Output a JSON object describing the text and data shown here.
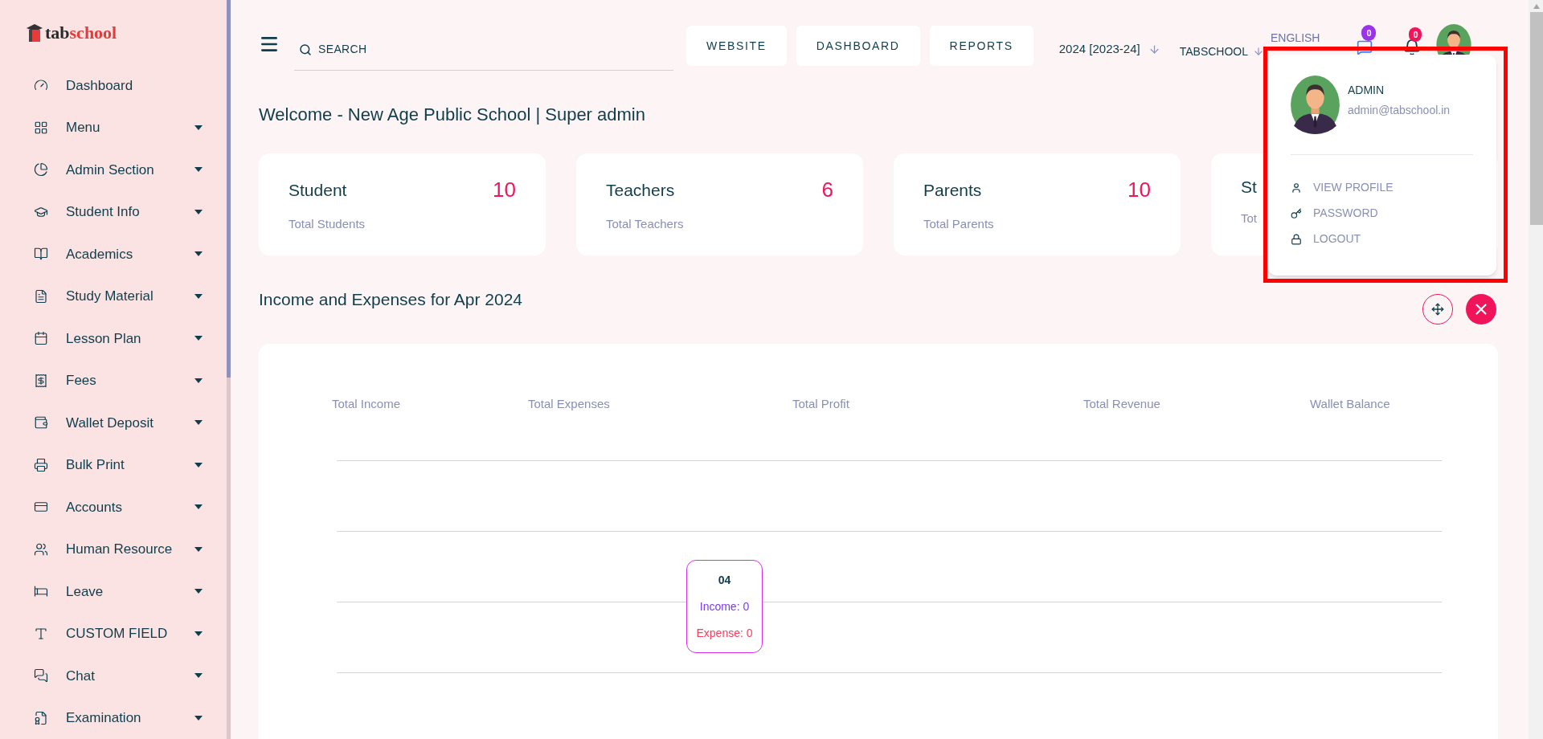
{
  "sidebar": {
    "logo": {
      "part1": "tab",
      "part2": "school"
    },
    "items": [
      {
        "label": "Dashboard",
        "has_submenu": false
      },
      {
        "label": "Menu",
        "has_submenu": true
      },
      {
        "label": "Admin Section",
        "has_submenu": true
      },
      {
        "label": "Student Info",
        "has_submenu": true
      },
      {
        "label": "Academics",
        "has_submenu": true
      },
      {
        "label": "Study Material",
        "has_submenu": true
      },
      {
        "label": "Lesson Plan",
        "has_submenu": true
      },
      {
        "label": "Fees",
        "has_submenu": true
      },
      {
        "label": "Wallet Deposit",
        "has_submenu": true
      },
      {
        "label": "Bulk Print",
        "has_submenu": true
      },
      {
        "label": "Accounts",
        "has_submenu": true
      },
      {
        "label": "Human Resource",
        "has_submenu": true
      },
      {
        "label": "Leave",
        "has_submenu": true
      },
      {
        "label": "CUSTOM FIELD",
        "has_submenu": true
      },
      {
        "label": "Chat",
        "has_submenu": true
      },
      {
        "label": "Examination",
        "has_submenu": true
      }
    ]
  },
  "header": {
    "search": {
      "placeholder": "SEARCH"
    },
    "nav_buttons": [
      "WEBSITE",
      "DASHBOARD",
      "REPORTS"
    ],
    "session": "2024 [2023-24]",
    "school": "TABSCHOOL",
    "language": "ENGLISH",
    "messages_badge": "0",
    "notifications_badge": "0"
  },
  "welcome": "Welcome - New Age Public School | Super admin",
  "stat_cards": [
    {
      "title": "Student",
      "value": "10",
      "subtitle": "Total Students"
    },
    {
      "title": "Teachers",
      "value": "6",
      "subtitle": "Total Teachers"
    },
    {
      "title": "Parents",
      "value": "10",
      "subtitle": "Total Parents"
    },
    {
      "title": "St",
      "subtitle": "Tot"
    }
  ],
  "income_section": {
    "title": "Income and Expenses for Apr 2024",
    "summary_labels": [
      "Total Income",
      "Total Expenses",
      "Total Profit",
      "Total Revenue",
      "Wallet Balance"
    ],
    "tooltip": {
      "label": "04",
      "income": "Income: 0",
      "expense": "Expense: 0"
    }
  },
  "profile_menu": {
    "name": "ADMIN",
    "email": "admin@tabschool.in",
    "items": [
      "VIEW PROFILE",
      "PASSWORD",
      "LOGOUT"
    ]
  }
}
